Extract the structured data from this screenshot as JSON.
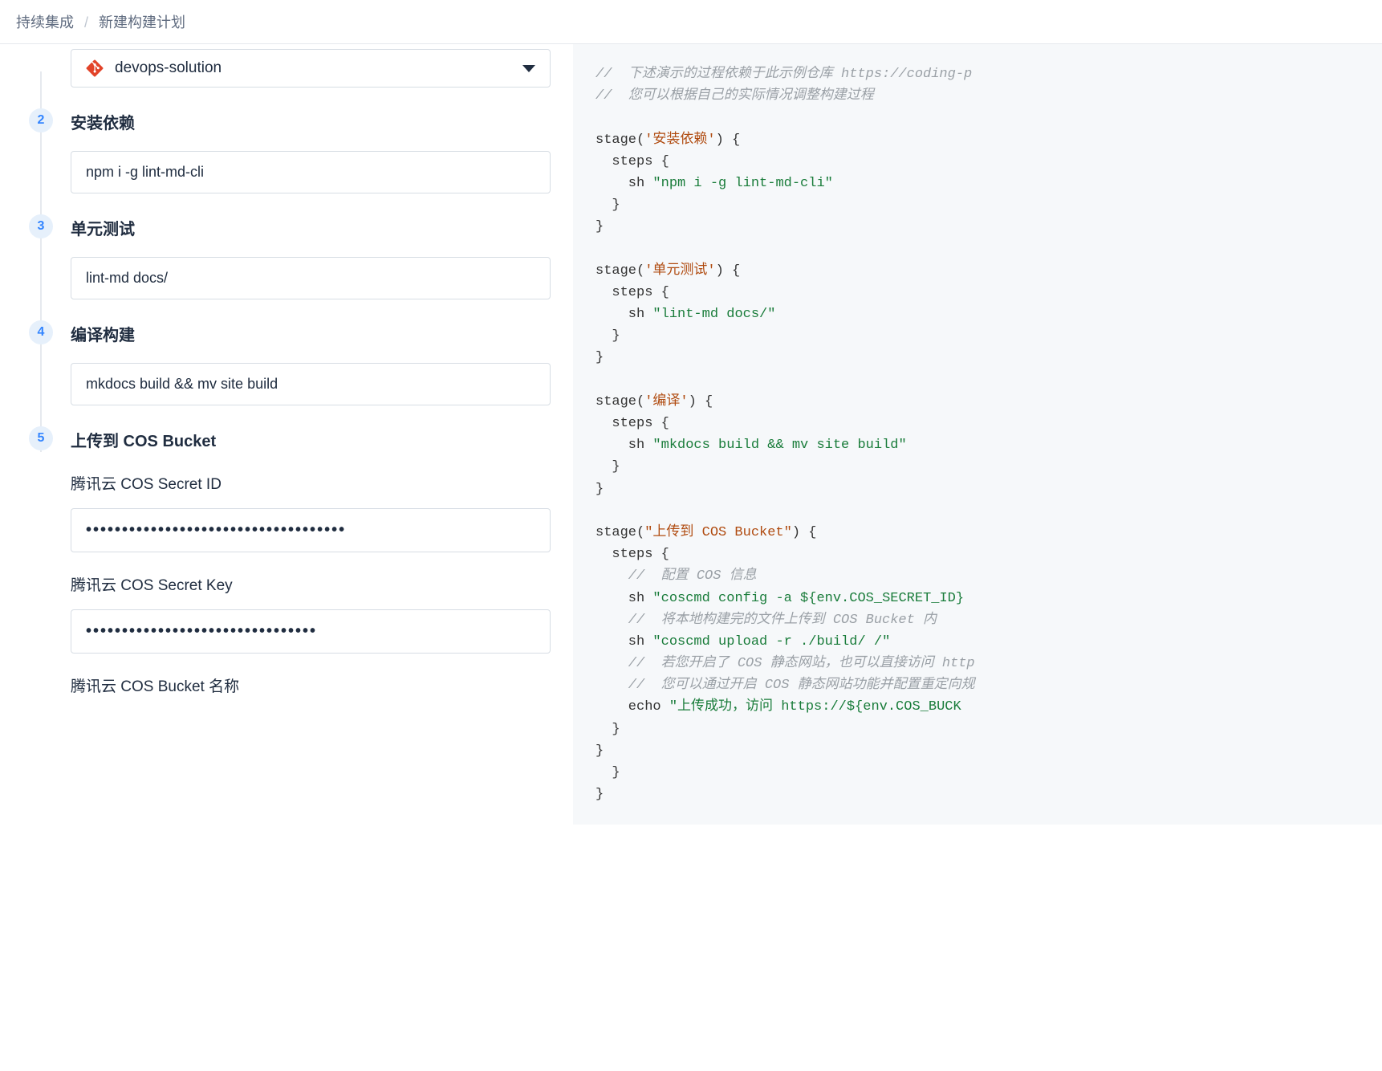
{
  "breadcrumb": {
    "parent": "持续集成",
    "current": "新建构建计划"
  },
  "steps": {
    "repo": {
      "selected": "devops-solution"
    },
    "s2": {
      "num": "2",
      "title": "安装依赖",
      "cmd": "npm i -g lint-md-cli"
    },
    "s3": {
      "num": "3",
      "title": "单元测试",
      "cmd": "lint-md docs/"
    },
    "s4": {
      "num": "4",
      "title": "编译构建",
      "cmd": "mkdocs build && mv site build"
    },
    "s5": {
      "num": "5",
      "title": "上传到 COS Bucket",
      "secret_id_label": "腾讯云 COS Secret ID",
      "secret_id_value": "••••••••••••••••••••••••••••••••••••",
      "secret_key_label": "腾讯云 COS Secret Key",
      "secret_key_value": "••••••••••••••••••••••••••••••••",
      "bucket_label": "腾讯云 COS Bucket 名称"
    }
  },
  "code": {
    "l1": "//  下述演示的过程依赖于此示例仓库 https://coding-p",
    "l2": "//  您可以根据自己的实际情况调整构建过程",
    "l3a": "stage(",
    "l3b": "'安装依赖'",
    "l3c": ") {",
    "l4": "  steps {",
    "l5a": "    sh ",
    "l5b": "\"npm i -g lint-md-cli\"",
    "l6": "  }",
    "l7": "}",
    "l8a": "stage(",
    "l8b": "'单元测试'",
    "l8c": ") {",
    "l9": "  steps {",
    "l10a": "    sh ",
    "l10b": "\"lint-md docs/\"",
    "l11": "  }",
    "l12": "}",
    "l13a": "stage(",
    "l13b": "'编译'",
    "l13c": ") {",
    "l14": "  steps {",
    "l15a": "    sh ",
    "l15b": "\"mkdocs build && mv site build\"",
    "l16": "  }",
    "l17": "}",
    "l18a": "stage(",
    "l18b": "\"上传到 COS Bucket\"",
    "l18c": ") {",
    "l19": "  steps {",
    "l20": "    //  配置 COS 信息",
    "l21a": "    sh ",
    "l21b": "\"coscmd config -a ${env.COS_SECRET_ID}",
    "l22": "    //  将本地构建完的文件上传到 COS Bucket 内",
    "l23a": "    sh ",
    "l23b": "\"coscmd upload -r ./build/ /\"",
    "l24": "    //  若您开启了 COS 静态网站，也可以直接访问 http",
    "l25": "    //  您可以通过开启 COS 静态网站功能并配置重定向规",
    "l26a": "    echo ",
    "l26b": "\"上传成功，访问 https://${env.COS_BUCK",
    "l27": "  }",
    "l28": "}",
    "l29": "  }",
    "l30": "}"
  }
}
